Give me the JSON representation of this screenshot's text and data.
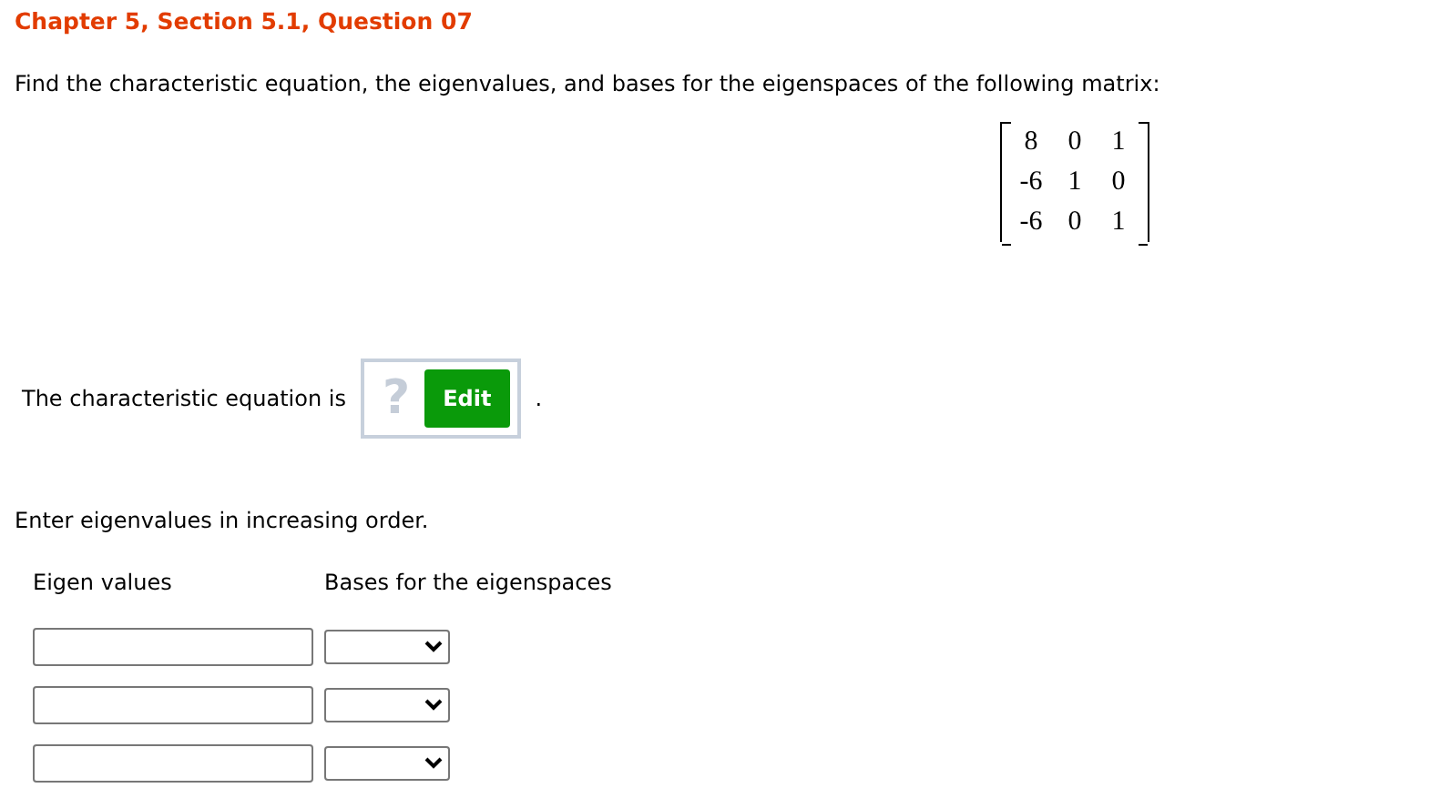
{
  "header": {
    "title": "Chapter 5, Section 5.1, Question 07"
  },
  "question": {
    "prompt": "Find the characteristic equation, the eigenvalues, and bases for the eigenspaces of the following matrix:",
    "matrix": [
      [
        "8",
        "0",
        "1"
      ],
      [
        "-6",
        "1",
        "0"
      ],
      [
        "-6",
        "0",
        "1"
      ]
    ]
  },
  "equation": {
    "label": "The characteristic equation is",
    "placeholder": "?",
    "button": "Edit",
    "end": "."
  },
  "instruction": "Enter eigenvalues in increasing order.",
  "table": {
    "columns": [
      "Eigen values",
      "Bases for the eigenspaces"
    ],
    "rows": [
      {
        "kind": "input_select"
      },
      {
        "kind": "input_select"
      },
      {
        "kind": "input_select"
      }
    ]
  }
}
